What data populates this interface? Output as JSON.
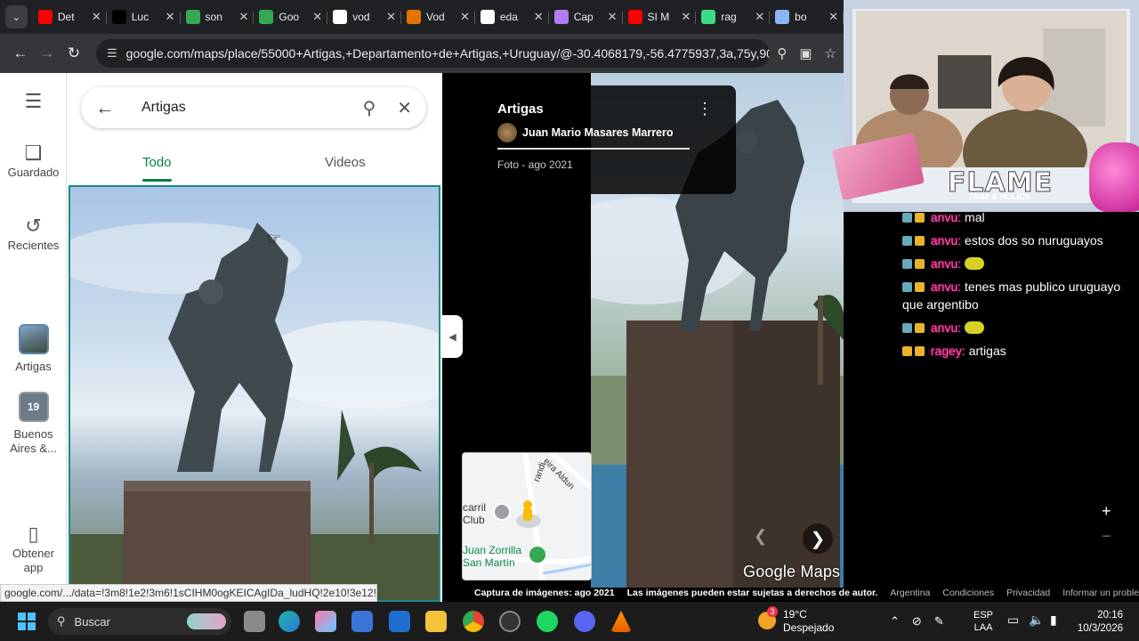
{
  "browser": {
    "tabs": [
      {
        "title": "Det",
        "favicon_color": "#ff0000",
        "icon": "youtube-icon"
      },
      {
        "title": "Luc",
        "favicon_color": "#000000",
        "icon": "tiktok-icon"
      },
      {
        "title": "son",
        "favicon_color": "#34a853",
        "icon": "drive-icon"
      },
      {
        "title": "Goo",
        "favicon_color": "#34a853",
        "icon": "drive-icon"
      },
      {
        "title": "vod",
        "favicon_color": "#ffffff",
        "icon": "google-icon"
      },
      {
        "title": "Vod",
        "favicon_color": "#e37400",
        "icon": "warning-triangle-icon"
      },
      {
        "title": "eda",
        "favicon_color": "#ffffff",
        "icon": "google-icon"
      },
      {
        "title": "Cap",
        "favicon_color": "#b37cf5",
        "icon": "pen-icon"
      },
      {
        "title": "SI M",
        "favicon_color": "#ff0000",
        "icon": "youtube-icon"
      },
      {
        "title": "rag",
        "favicon_color": "#3ddc84",
        "icon": "kick-icon"
      },
      {
        "title": "bo",
        "favicon_color": "#8ab4f8",
        "icon": "bot-icon"
      }
    ],
    "url": "google.com/maps/place/55000+Artigas,+Departamento+de+Artigas,+Uruguay/@-30.4068179,-56.4775937,3a,75y,90t/d..."
  },
  "maps": {
    "rail": {
      "saved": "Guardado",
      "recents": "Recientes",
      "artigas": "Artigas",
      "buenos_aires": "Buenos Aires &...",
      "buenos_aires_count": "19",
      "get_app": "Obtener app"
    },
    "search": {
      "query": "Artigas"
    },
    "tabs": {
      "all": "Todo",
      "videos": "Videos"
    },
    "photo_card": {
      "title": "Artigas",
      "author": "Juan Mario Masares Marrero",
      "date": "Foto - ago 2021"
    },
    "minimap": {
      "labels": [
        "carril",
        "Club",
        "Juan Zorrilla",
        "San Martín",
        "eira Aldun",
        "randi"
      ]
    },
    "logo": "Google Maps",
    "status_url": "google.com/.../data=!3m8!1e2!3m6!1sCIHM0ogKEICAgIDa_ludHQ!2e10!3e12!6sh...",
    "attribution": {
      "capture": "Captura de imágenes: ago 2021",
      "rights": "Las imágenes pueden estar sujetas a derechos de autor.",
      "country": "Argentina",
      "terms": "Condiciones",
      "privacy": "Privacidad",
      "report": "Informar un problema"
    }
  },
  "stream": {
    "banner": "FLAME",
    "banner_sub": "TRAP & HOLICS",
    "chat": [
      {
        "user": "anvu:",
        "text": "mal"
      },
      {
        "user": "anvu:",
        "text": "estos dos so nuruguayos"
      },
      {
        "user": "anvu:",
        "text": ""
      },
      {
        "user": "anvu:",
        "text": "tenes mas publico uruguayo que argentibo"
      },
      {
        "user": "anvu:",
        "text": ""
      },
      {
        "user": "ragey:",
        "text": "artigas"
      }
    ]
  },
  "taskbar": {
    "search": "Buscar",
    "weather_temp": "19°C",
    "weather_desc": "Despejado",
    "weather_badge": "3",
    "lang1": "ESP",
    "lang2": "LAA",
    "time": "20:16",
    "date": "10/3/2026"
  }
}
